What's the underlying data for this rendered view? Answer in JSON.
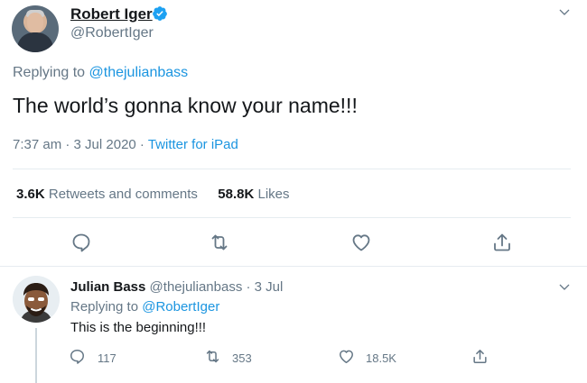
{
  "tweet": {
    "author_name": "Robert Iger",
    "author_handle": "@RobertIger",
    "replying_prefix": "Replying to ",
    "replying_handle": "@thejulianbass",
    "text": "The world’s gonna know your name!!!",
    "time": "7:37 am · 3 Jul 2020 · ",
    "source": "Twitter for iPad",
    "retweets_count": "3.6K",
    "retweets_label": " Retweets and comments",
    "likes_count": "58.8K",
    "likes_label": " Likes"
  },
  "reply": {
    "author_name": "Julian Bass",
    "author_handle": "@thejulianbass",
    "date": " · 3 Jul",
    "replying_prefix": "Replying to ",
    "replying_handle": "@RobertIger",
    "text": "This is the beginning!!!",
    "reply_count": "117",
    "retweet_count": "353",
    "like_count": "18.5K"
  },
  "icons": {
    "verified": "verified-badge-icon",
    "chevron": "chevron-down-icon",
    "reply": "reply-icon",
    "retweet": "retweet-icon",
    "like": "heart-icon",
    "share": "share-icon"
  },
  "colors": {
    "link": "#1b95e0",
    "muted": "#657786",
    "text": "#14171a",
    "divider": "#e6ecf0"
  }
}
